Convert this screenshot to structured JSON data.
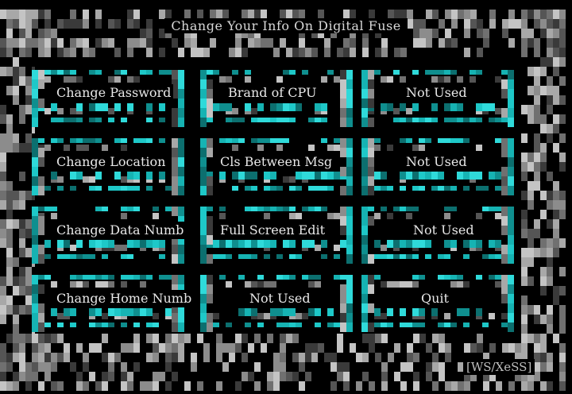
{
  "title": "Change Your Info On Digital Fuse",
  "colors": {
    "accent": "#1ec8c8",
    "background": "#000000",
    "text": "#e8e8e8",
    "frame": "#8a8a8a"
  },
  "menu": {
    "row1": [
      "Change Password",
      "Brand of CPU",
      "Not Used"
    ],
    "row2": [
      "Change Location",
      "Cls Between Msg",
      "Not Used"
    ],
    "row3": [
      "Change Data Numb",
      "Full Screen Edit",
      "Not Used"
    ],
    "row4": [
      "Change Home Numb",
      "Not Used",
      "Quit"
    ]
  },
  "signature": "[WS/XeSS]"
}
